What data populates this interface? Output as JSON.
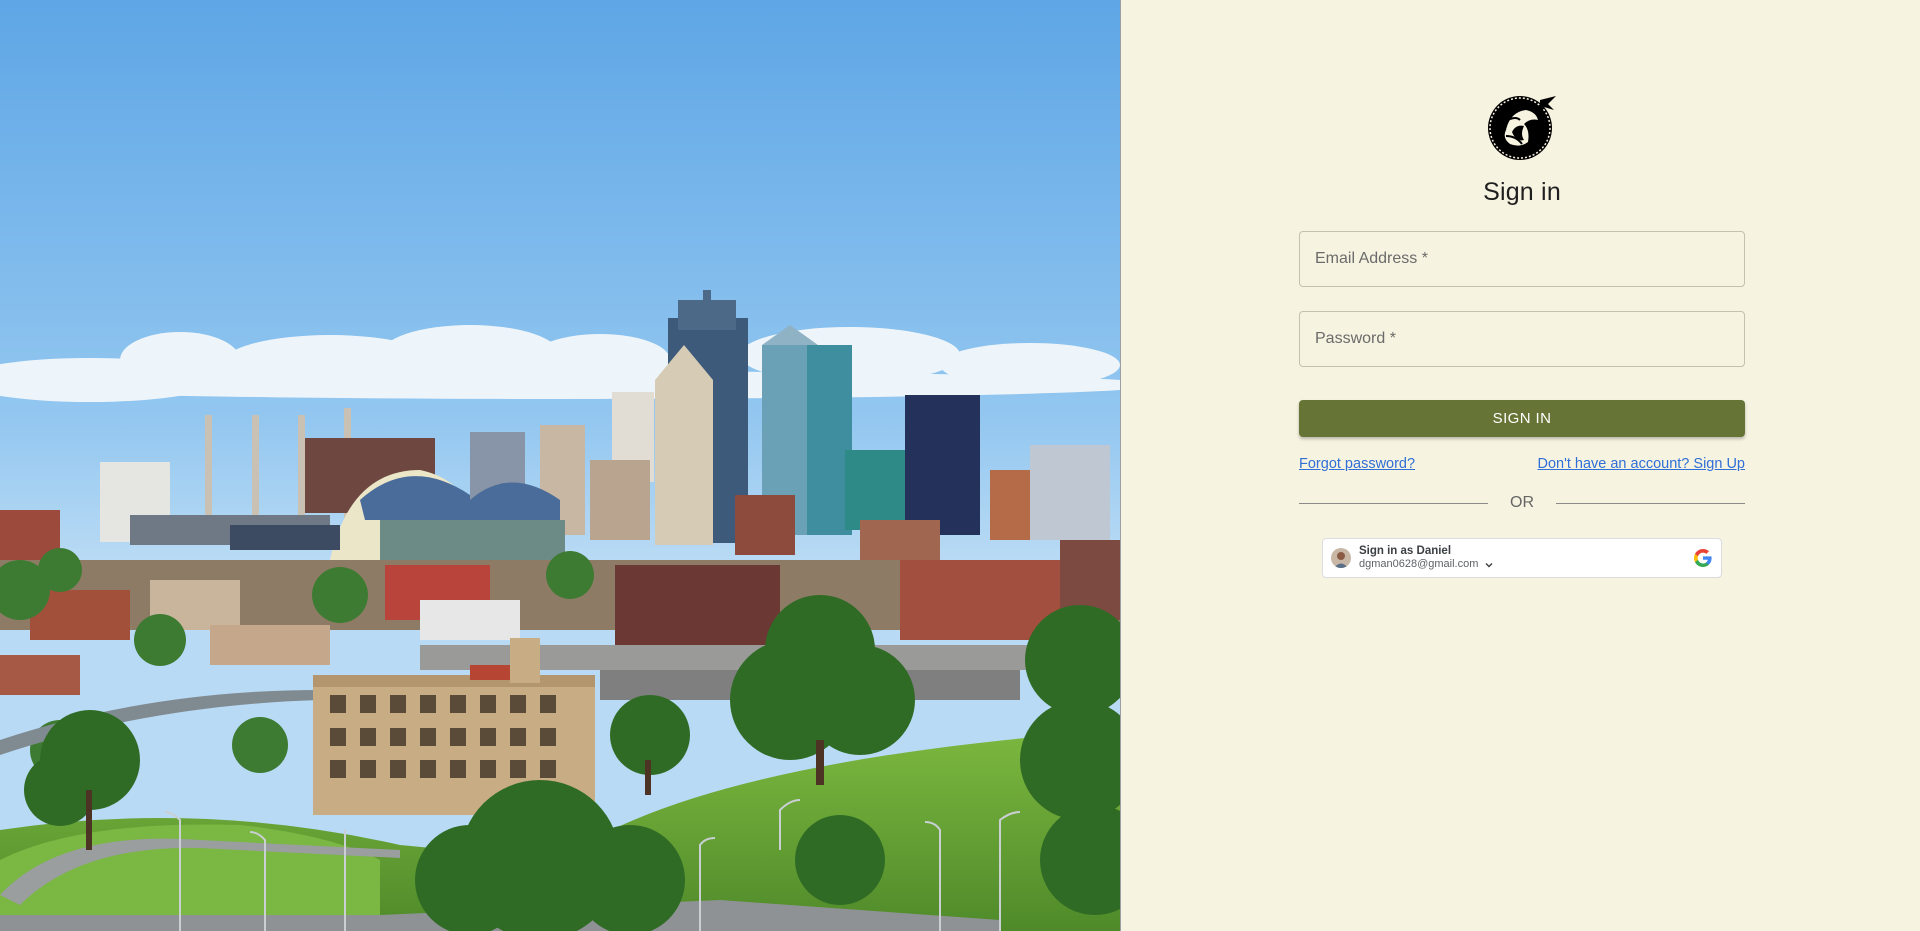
{
  "photo": {
    "description_icon": "city-skyline-photo"
  },
  "logo": {
    "icon": "pegasus-logo-icon"
  },
  "form": {
    "title": "Sign in",
    "email": {
      "placeholder": "Email Address *",
      "value": ""
    },
    "password": {
      "placeholder": "Password *",
      "value": ""
    },
    "submit_label": "SIGN IN",
    "forgot_label": "Forgot password?",
    "signup_label": "Don't have an account? Sign Up",
    "or_label": "OR"
  },
  "google": {
    "name_label": "Sign in as Daniel",
    "email": "dgman0628@gmail.com",
    "icon": "google-g-icon",
    "chevron_icon": "chevron-down-icon"
  },
  "colors": {
    "panel_background": "#f7f3e1",
    "primary_button": "#667435",
    "link": "#2f6fd6",
    "sky_top": "#5ea6e6",
    "grass": "#6aa33a"
  }
}
